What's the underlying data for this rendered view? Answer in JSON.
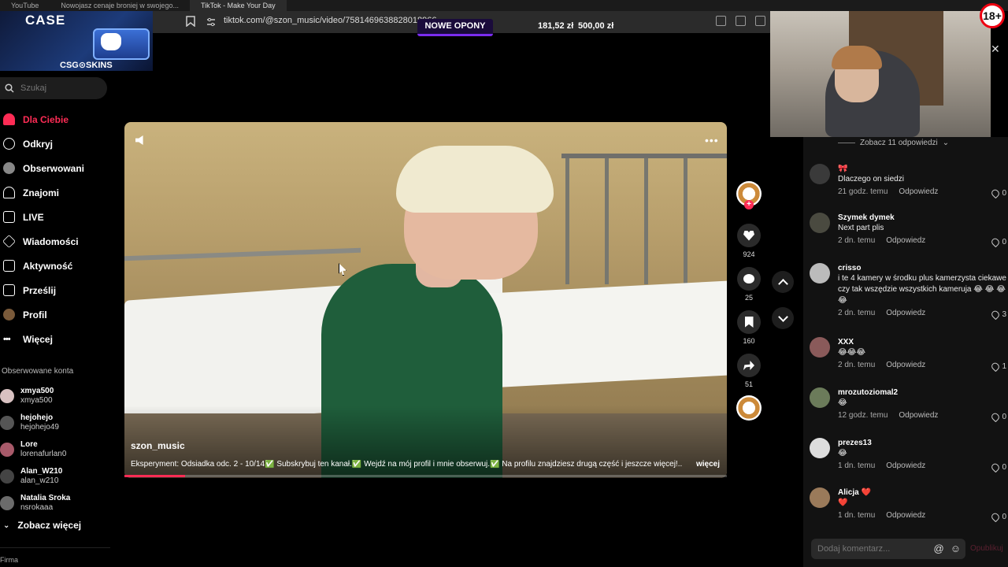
{
  "browser": {
    "tabs": [
      "YouTube",
      "Nowojasz cenaje broniej w swojego...",
      "TikTok - Make Your Day"
    ],
    "url": "tiktok.com/@szon_music/video/7581469638828018966"
  },
  "overlay": {
    "case_title": "CASE",
    "case_logo": "CSG⊙SKINS",
    "promo_label": "NOWE OPONY",
    "money_1": "181,52 zł",
    "money_2": "500,00 zł",
    "age_badge": "18+",
    "close_symbol": "✕"
  },
  "sidebar": {
    "search_placeholder": "Szukaj",
    "nav": [
      {
        "label": "Dla Ciebie",
        "icon": "home-icon"
      },
      {
        "label": "Odkryj",
        "icon": "compass-icon"
      },
      {
        "label": "Obserwowani",
        "icon": "following-icon"
      },
      {
        "label": "Znajomi",
        "icon": "friends-icon"
      },
      {
        "label": "LIVE",
        "icon": "live-icon"
      },
      {
        "label": "Wiadomości",
        "icon": "messages-icon"
      },
      {
        "label": "Aktywność",
        "icon": "activity-icon"
      },
      {
        "label": "Prześlij",
        "icon": "upload-icon"
      },
      {
        "label": "Profil",
        "icon": "profile-icon"
      },
      {
        "label": "Więcej",
        "icon": "more-icon"
      }
    ],
    "following_title": "Obserwowane konta",
    "following": [
      {
        "name": "xmya500",
        "user": "xmya500"
      },
      {
        "name": "hejohejo",
        "user": "hejohejo49"
      },
      {
        "name": "Lore",
        "user": "lorenafurlan0"
      },
      {
        "name": "Alan_W210",
        "user": "alan_w210"
      },
      {
        "name": "Natalia Sroka",
        "user": "nsrokaaa"
      }
    ],
    "see_more": "Zobacz więcej",
    "footer": "Firma"
  },
  "video": {
    "author": "szon_music",
    "description": "Eksperyment: Odsiadka odc. 2 - 10/14✅ Subskrybuj ten kanał.✅ Wejdź na mój profil i mnie obserwuj.✅ Na profilu znajdziesz drugą część i jeszcze więcej!...",
    "more_label": "więcej",
    "progress": 0.1,
    "more_dots": "•••"
  },
  "actions": {
    "plus": "+",
    "likes": "924",
    "comments": "25",
    "saves": "160",
    "shares": "51"
  },
  "comments": {
    "view_replies": "Zobacz 11 odpowiedzi",
    "reply_label": "Odpowiedz",
    "items": [
      {
        "user": "🎀",
        "text": "Dlaczego on siedzi",
        "time": "21 godz. temu",
        "likes": "0"
      },
      {
        "user": "Szymek dymek",
        "text": "Next part plis",
        "time": "2 dn. temu",
        "likes": "0"
      },
      {
        "user": "crisso",
        "text": "i te 4 kamery w środku plus kamerzysta ciekawe czy tak wszędzie wszystkich kameruja 😂 😂 😂 😂",
        "time": "2 dn. temu",
        "likes": "3"
      },
      {
        "user": "XXX",
        "text": "😂😂😂",
        "time": "2 dn. temu",
        "likes": "1"
      },
      {
        "user": "mrozutoziomal2",
        "text": "😂",
        "time": "12 godz. temu",
        "likes": "0"
      },
      {
        "user": "prezes13",
        "text": "😂",
        "time": "1 dn. temu",
        "likes": "0"
      },
      {
        "user": "Alicja ❤️",
        "text": "❤️",
        "time": "1 dn. temu",
        "likes": "0"
      }
    ],
    "input_placeholder": "Dodaj komentarz...",
    "post_label": "Opublikuj"
  }
}
